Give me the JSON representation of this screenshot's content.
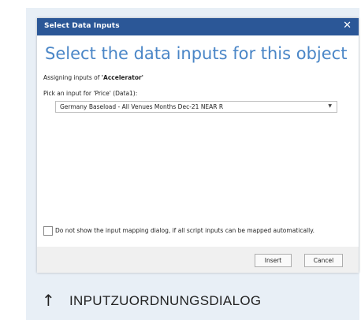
{
  "dialog": {
    "title": "Select Data Inputs",
    "close_icon": "close-icon",
    "heading": "Select the data inputs for this object",
    "assign_prefix": "Assigning inputs of ",
    "assign_object": "'Accelerator'",
    "pick_label": "Pick an input for 'Price' (Data1):",
    "select_value": "Germany Baseload - All Venues Months Dec-21 NEAR R",
    "select_caret": "▼",
    "checkbox_label": "Do not show the input mapping dialog, if all script inputs can be mapped automatically.",
    "checkbox_checked": false,
    "insert_label": "Insert",
    "cancel_label": "Cancel"
  },
  "banner": {
    "arrow_icon": "↑",
    "text": "INPUTZUORDNUNGSDIALOG"
  },
  "colors": {
    "titlebar": "#2b5797",
    "heading": "#4a86c7",
    "panel": "#e8eff6"
  }
}
